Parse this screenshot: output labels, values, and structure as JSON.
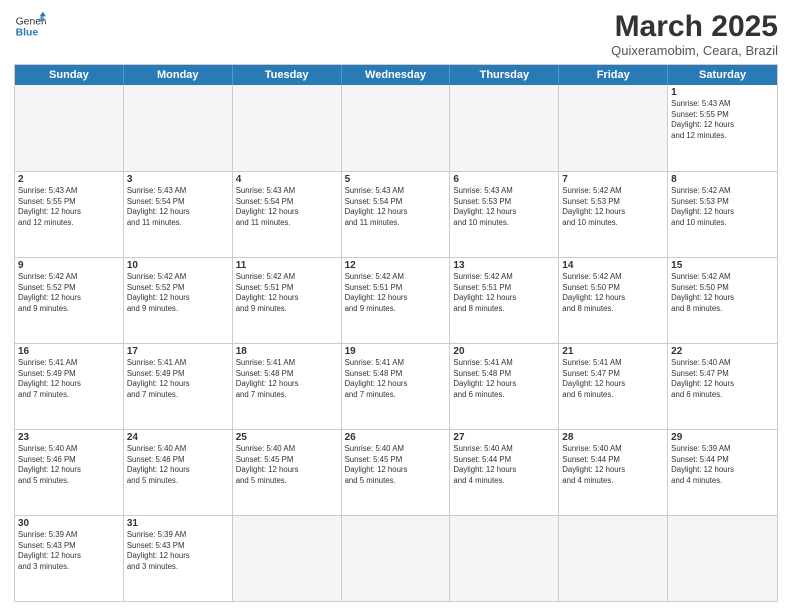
{
  "header": {
    "logo_general": "General",
    "logo_blue": "Blue",
    "title": "March 2025",
    "subtitle": "Quixeramobim, Ceara, Brazil"
  },
  "days_of_week": [
    "Sunday",
    "Monday",
    "Tuesday",
    "Wednesday",
    "Thursday",
    "Friday",
    "Saturday"
  ],
  "weeks": [
    [
      {
        "num": "",
        "info": "",
        "empty": true
      },
      {
        "num": "",
        "info": "",
        "empty": true
      },
      {
        "num": "",
        "info": "",
        "empty": true
      },
      {
        "num": "",
        "info": "",
        "empty": true
      },
      {
        "num": "",
        "info": "",
        "empty": true
      },
      {
        "num": "",
        "info": "",
        "empty": true
      },
      {
        "num": "1",
        "info": "Sunrise: 5:43 AM\nSunset: 5:55 PM\nDaylight: 12 hours\nand 12 minutes.",
        "empty": false
      }
    ],
    [
      {
        "num": "2",
        "info": "Sunrise: 5:43 AM\nSunset: 5:55 PM\nDaylight: 12 hours\nand 12 minutes.",
        "empty": false
      },
      {
        "num": "3",
        "info": "Sunrise: 5:43 AM\nSunset: 5:54 PM\nDaylight: 12 hours\nand 11 minutes.",
        "empty": false
      },
      {
        "num": "4",
        "info": "Sunrise: 5:43 AM\nSunset: 5:54 PM\nDaylight: 12 hours\nand 11 minutes.",
        "empty": false
      },
      {
        "num": "5",
        "info": "Sunrise: 5:43 AM\nSunset: 5:54 PM\nDaylight: 12 hours\nand 11 minutes.",
        "empty": false
      },
      {
        "num": "6",
        "info": "Sunrise: 5:43 AM\nSunset: 5:53 PM\nDaylight: 12 hours\nand 10 minutes.",
        "empty": false
      },
      {
        "num": "7",
        "info": "Sunrise: 5:42 AM\nSunset: 5:53 PM\nDaylight: 12 hours\nand 10 minutes.",
        "empty": false
      },
      {
        "num": "8",
        "info": "Sunrise: 5:42 AM\nSunset: 5:53 PM\nDaylight: 12 hours\nand 10 minutes.",
        "empty": false
      }
    ],
    [
      {
        "num": "9",
        "info": "Sunrise: 5:42 AM\nSunset: 5:52 PM\nDaylight: 12 hours\nand 9 minutes.",
        "empty": false
      },
      {
        "num": "10",
        "info": "Sunrise: 5:42 AM\nSunset: 5:52 PM\nDaylight: 12 hours\nand 9 minutes.",
        "empty": false
      },
      {
        "num": "11",
        "info": "Sunrise: 5:42 AM\nSunset: 5:51 PM\nDaylight: 12 hours\nand 9 minutes.",
        "empty": false
      },
      {
        "num": "12",
        "info": "Sunrise: 5:42 AM\nSunset: 5:51 PM\nDaylight: 12 hours\nand 9 minutes.",
        "empty": false
      },
      {
        "num": "13",
        "info": "Sunrise: 5:42 AM\nSunset: 5:51 PM\nDaylight: 12 hours\nand 8 minutes.",
        "empty": false
      },
      {
        "num": "14",
        "info": "Sunrise: 5:42 AM\nSunset: 5:50 PM\nDaylight: 12 hours\nand 8 minutes.",
        "empty": false
      },
      {
        "num": "15",
        "info": "Sunrise: 5:42 AM\nSunset: 5:50 PM\nDaylight: 12 hours\nand 8 minutes.",
        "empty": false
      }
    ],
    [
      {
        "num": "16",
        "info": "Sunrise: 5:41 AM\nSunset: 5:49 PM\nDaylight: 12 hours\nand 7 minutes.",
        "empty": false
      },
      {
        "num": "17",
        "info": "Sunrise: 5:41 AM\nSunset: 5:49 PM\nDaylight: 12 hours\nand 7 minutes.",
        "empty": false
      },
      {
        "num": "18",
        "info": "Sunrise: 5:41 AM\nSunset: 5:48 PM\nDaylight: 12 hours\nand 7 minutes.",
        "empty": false
      },
      {
        "num": "19",
        "info": "Sunrise: 5:41 AM\nSunset: 5:48 PM\nDaylight: 12 hours\nand 7 minutes.",
        "empty": false
      },
      {
        "num": "20",
        "info": "Sunrise: 5:41 AM\nSunset: 5:48 PM\nDaylight: 12 hours\nand 6 minutes.",
        "empty": false
      },
      {
        "num": "21",
        "info": "Sunrise: 5:41 AM\nSunset: 5:47 PM\nDaylight: 12 hours\nand 6 minutes.",
        "empty": false
      },
      {
        "num": "22",
        "info": "Sunrise: 5:40 AM\nSunset: 5:47 PM\nDaylight: 12 hours\nand 6 minutes.",
        "empty": false
      }
    ],
    [
      {
        "num": "23",
        "info": "Sunrise: 5:40 AM\nSunset: 5:46 PM\nDaylight: 12 hours\nand 5 minutes.",
        "empty": false
      },
      {
        "num": "24",
        "info": "Sunrise: 5:40 AM\nSunset: 5:46 PM\nDaylight: 12 hours\nand 5 minutes.",
        "empty": false
      },
      {
        "num": "25",
        "info": "Sunrise: 5:40 AM\nSunset: 5:45 PM\nDaylight: 12 hours\nand 5 minutes.",
        "empty": false
      },
      {
        "num": "26",
        "info": "Sunrise: 5:40 AM\nSunset: 5:45 PM\nDaylight: 12 hours\nand 5 minutes.",
        "empty": false
      },
      {
        "num": "27",
        "info": "Sunrise: 5:40 AM\nSunset: 5:44 PM\nDaylight: 12 hours\nand 4 minutes.",
        "empty": false
      },
      {
        "num": "28",
        "info": "Sunrise: 5:40 AM\nSunset: 5:44 PM\nDaylight: 12 hours\nand 4 minutes.",
        "empty": false
      },
      {
        "num": "29",
        "info": "Sunrise: 5:39 AM\nSunset: 5:44 PM\nDaylight: 12 hours\nand 4 minutes.",
        "empty": false
      }
    ],
    [
      {
        "num": "30",
        "info": "Sunrise: 5:39 AM\nSunset: 5:43 PM\nDaylight: 12 hours\nand 3 minutes.",
        "empty": false
      },
      {
        "num": "31",
        "info": "Sunrise: 5:39 AM\nSunset: 5:43 PM\nDaylight: 12 hours\nand 3 minutes.",
        "empty": false
      },
      {
        "num": "",
        "info": "",
        "empty": true
      },
      {
        "num": "",
        "info": "",
        "empty": true
      },
      {
        "num": "",
        "info": "",
        "empty": true
      },
      {
        "num": "",
        "info": "",
        "empty": true
      },
      {
        "num": "",
        "info": "",
        "empty": true
      }
    ]
  ]
}
